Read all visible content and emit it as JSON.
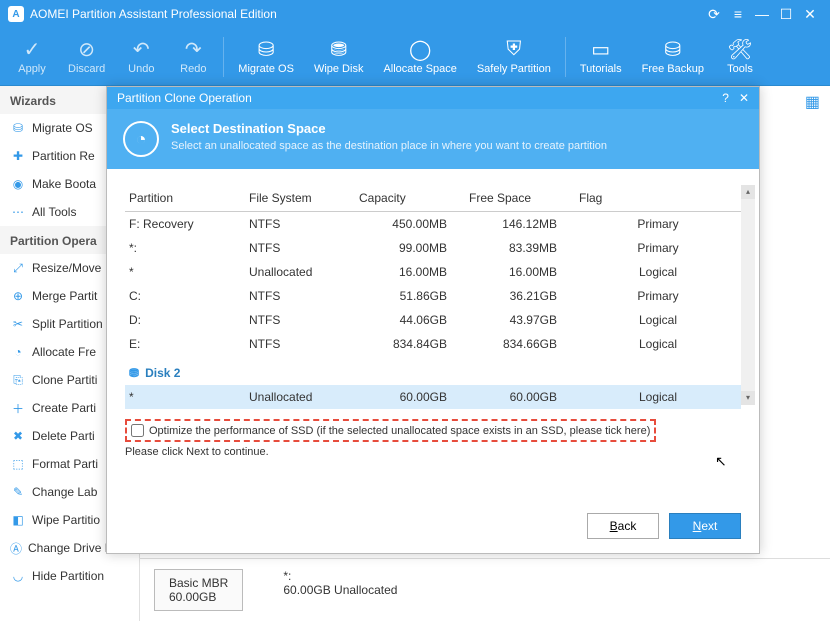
{
  "title": "AOMEI Partition Assistant Professional Edition",
  "toolbar": {
    "apply": "Apply",
    "discard": "Discard",
    "undo": "Undo",
    "redo": "Redo",
    "migrate": "Migrate OS",
    "wipe": "Wipe Disk",
    "allocate": "Allocate Space",
    "safely": "Safely Partition",
    "tutorials": "Tutorials",
    "backup": "Free Backup",
    "tools": "Tools"
  },
  "sidebar": {
    "wizards_title": "Wizards",
    "wizards": [
      "Migrate OS",
      "Partition Re",
      "Make Boota",
      "All Tools"
    ],
    "ops_title": "Partition Opera",
    "ops": [
      "Resize/Move",
      "Merge Partit",
      "Split Partition",
      "Allocate Fre",
      "Clone Partiti",
      "Create Parti",
      "Delete Parti",
      "Format Parti",
      "Change Lab",
      "Wipe Partitio",
      "Change Drive Letter",
      "Hide Partition"
    ]
  },
  "modal": {
    "strip_title": "Partition Clone Operation",
    "banner_title": "Select Destination Space",
    "banner_sub": "Select an unallocated space as the destination place in where you want to create partition",
    "headers": {
      "partition": "Partition",
      "fs": "File System",
      "cap": "Capacity",
      "free": "Free Space",
      "flag": "Flag"
    },
    "rows": [
      {
        "p": "F: Recovery",
        "fs": "NTFS",
        "cap": "450.00MB",
        "free": "146.12MB",
        "flag": "Primary"
      },
      {
        "p": "*:",
        "fs": "NTFS",
        "cap": "99.00MB",
        "free": "83.39MB",
        "flag": "Primary"
      },
      {
        "p": "*",
        "fs": "Unallocated",
        "cap": "16.00MB",
        "free": "16.00MB",
        "flag": "Logical"
      },
      {
        "p": "C:",
        "fs": "NTFS",
        "cap": "51.86GB",
        "free": "36.21GB",
        "flag": "Primary"
      },
      {
        "p": "D:",
        "fs": "NTFS",
        "cap": "44.06GB",
        "free": "43.97GB",
        "flag": "Logical"
      },
      {
        "p": "E:",
        "fs": "NTFS",
        "cap": "834.84GB",
        "free": "834.66GB",
        "flag": "Logical"
      }
    ],
    "disk2": "Disk 2",
    "sel": {
      "p": "*",
      "fs": "Unallocated",
      "cap": "60.00GB",
      "free": "60.00GB",
      "flag": "Logical"
    },
    "ssd_opt": "Optimize the performance of SSD (if the selected unallocated space exists in an SSD, please tick here)",
    "hint": "Please click Next to continue.",
    "back": "ack",
    "next": "ext"
  },
  "bottom": {
    "disk_name": "Basic MBR",
    "disk_size": "60.00GB",
    "part": "*:",
    "part_desc": "60.00GB Unallocated"
  }
}
